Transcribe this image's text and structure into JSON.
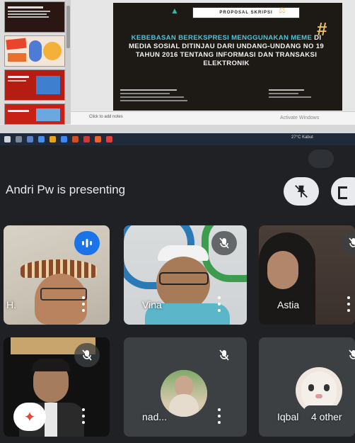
{
  "slides_app": {
    "slide": {
      "header": "PROPOSAL SKRIPSI",
      "title_highlight": "KEBEBASAN BEREKSPRESI MENGGUNAKAN MEME",
      "title_rest": "DI MEDIA SOSIAL DITINJAU DARI UNDANG-UNDANG NO 19 TAHUN 2016 TENTANG INFORMASI DAN TRANSAKSI ELEKTRONIK",
      "hash": "#"
    },
    "notes_placeholder": "Click to add notes",
    "activate_windows": "Activate Windows"
  },
  "taskbar": {
    "weather": "27°C  Kabut"
  },
  "meet": {
    "presenting_label": "Andri Pw is presenting",
    "participants": [
      {
        "name": "H.",
        "speaking": true
      },
      {
        "name": "Vina",
        "muted": true
      },
      {
        "name": "Astia",
        "muted": true
      },
      {
        "name": "",
        "muted": true
      },
      {
        "name": "nad...",
        "muted": true
      },
      {
        "name": "Iqbal",
        "muted": true
      }
    ],
    "others_label": "4 other"
  }
}
